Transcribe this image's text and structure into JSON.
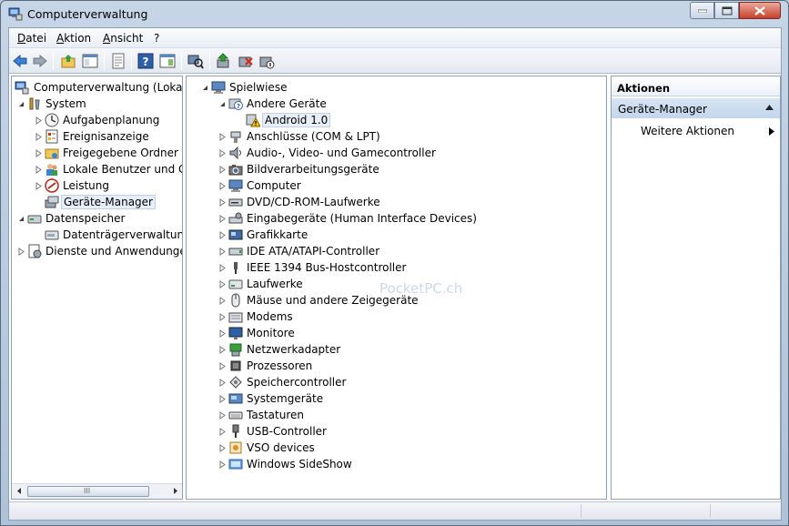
{
  "window": {
    "title": "Computerverwaltung"
  },
  "menu": [
    "Datei",
    "Aktion",
    "Ansicht",
    "?"
  ],
  "left_tree": [
    {
      "label": "Computerverwaltung (Lokal)",
      "icon": "computer-management-icon"
    },
    {
      "label": "System",
      "icon": "system-tools-icon"
    },
    {
      "label": "Aufgabenplanung",
      "icon": "task-scheduler-icon"
    },
    {
      "label": "Ereignisanzeige",
      "icon": "event-viewer-icon"
    },
    {
      "label": "Freigegebene Ordner",
      "icon": "shared-folders-icon"
    },
    {
      "label": "Lokale Benutzer und Gruppen",
      "icon": "local-users-icon"
    },
    {
      "label": "Leistung",
      "icon": "performance-icon"
    },
    {
      "label": "Geräte-Manager",
      "icon": "device-manager-icon"
    },
    {
      "label": "Datenspeicher",
      "icon": "storage-icon"
    },
    {
      "label": "Datenträgerverwaltung",
      "icon": "disk-management-icon"
    },
    {
      "label": "Dienste und Anwendungen",
      "icon": "services-icon"
    }
  ],
  "device_tree": {
    "root": "Spielwiese",
    "other_devices": "Andere Geräte",
    "android": "Android 1.0",
    "categories": [
      "Anschlüsse (COM & LPT)",
      "Audio-, Video- und Gamecontroller",
      "Bildverarbeitungsgeräte",
      "Computer",
      "DVD/CD-ROM-Laufwerke",
      "Eingabegeräte (Human Interface Devices)",
      "Grafikkarte",
      "IDE ATA/ATAPI-Controller",
      "IEEE 1394 Bus-Hostcontroller",
      "Laufwerke",
      "Mäuse und andere Zeigegeräte",
      "Modems",
      "Monitore",
      "Netzwerkadapter",
      "Prozessoren",
      "Speichercontroller",
      "Systemgeräte",
      "Tastaturen",
      "USB-Controller",
      "VSO devices",
      "Windows SideShow"
    ]
  },
  "actions": {
    "header": "Aktionen",
    "section": "Geräte-Manager",
    "more": "Weitere Aktionen"
  },
  "watermark": "PocketPC.ch",
  "scrollbar_grip": "III"
}
